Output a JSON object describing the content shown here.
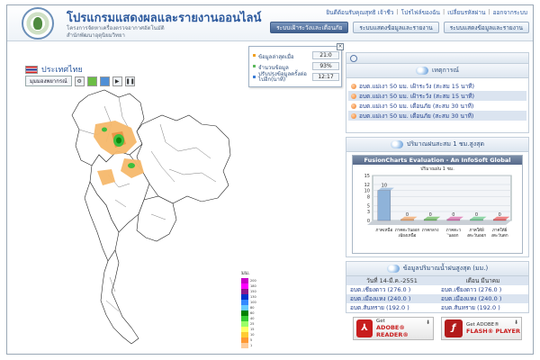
{
  "header": {
    "title": "โปรแกรมแสดงผลและรายงานออนไลน์",
    "subtitle_1": "โครงการจัดหาเครื่องตรวจอากาศอัตโนมัติ",
    "subtitle_2": "สำนักพัฒนาอุตุนิยมวิทยา",
    "top_links": [
      "ยินดีต้อนรับคุณสุทธิ เจ้าชีว",
      "โปรไฟล์ของฉัน",
      "เปลี่ยนรหัสผ่าน",
      "ออกจากระบบ"
    ],
    "nav": [
      "ระบบเฝ้าระวังและเตือนภัย",
      "ระบบแสดงข้อมูลและรายงาน",
      "ระบบแสดงข้อมูลและรายงาน"
    ]
  },
  "map": {
    "country_label": "ประเทศไทย",
    "select_value": "มุมมองพยากรณ์",
    "info_box": {
      "rows": [
        {
          "label": "ข้อมูลล่าสุดเมื่อ",
          "value": "21:0",
          "color": "#f0a020"
        },
        {
          "label": "จำนวนข้อมูล",
          "value": "93%",
          "color": "#5cb85c"
        },
        {
          "label": "ปรับปรุงข้อมูลครั้งต่อไปอีก(นาที)",
          "value": "12:17",
          "color": "#3a7bd5"
        }
      ]
    },
    "legend": {
      "title": "มม.",
      "levels": [
        {
          "label": "200",
          "color": "#c800c8"
        },
        {
          "label": "180",
          "color": "#ff00ff"
        },
        {
          "label": "150",
          "color": "#8c1a8c"
        },
        {
          "label": "130",
          "color": "#0033cc"
        },
        {
          "label": "100",
          "color": "#3388ff"
        },
        {
          "label": "80",
          "color": "#66ccff"
        },
        {
          "label": "60",
          "color": "#008000"
        },
        {
          "label": "40",
          "color": "#33cc33"
        },
        {
          "label": "25",
          "color": "#99ff66"
        },
        {
          "label": "15",
          "color": "#ffff66"
        },
        {
          "label": "10",
          "color": "#ffcc33"
        },
        {
          "label": "5",
          "color": "#ff9933"
        },
        {
          "label": "1",
          "color": "#ffcc99"
        }
      ]
    }
  },
  "events": {
    "title": "เหตุการณ์",
    "items": [
      "อบต.แม่เงา 50 มม. เฝ้าระวัง (สะสม 15 นาที)",
      "อบต.แม่เงา 50 มม. เฝ้าระวัง (สะสม 15 นาที)",
      "อบต.แม่เงา 50 มม. เตือนภัย (สะสม 30 นาที)",
      "อบต.แม่เงา 50 มม. เตือนภัย (สะสม 30 นาที)"
    ]
  },
  "rain_panel": {
    "title": "ปริมาณฝนสะสม 1 ชม.สูงสุด",
    "chart_title": "FusionCharts Evaluation - An InfoSoft Global",
    "chart_subtitle": "ปริมาณฝน 1 ชม."
  },
  "chart_data": {
    "type": "bar",
    "title": "ปริมาณฝน 1 ชม.",
    "categories": [
      "ภาคเหนือ",
      "ภาคตะวันออกเฉียงเหนือ",
      "ภาคกลาง",
      "ภาคตะวันออก",
      "ภาคใต้ฝั่งตะวันออก",
      "ภาคใต้ฝั่งตะวันตก"
    ],
    "values": [
      10,
      0,
      0,
      0,
      0,
      0
    ],
    "ylim": [
      0,
      15
    ],
    "yticks": [
      0,
      3,
      5,
      8,
      10,
      12,
      15
    ],
    "grid": true,
    "colors": [
      "#8fb3d9",
      "#f4a460",
      "#66bb55",
      "#dd66aa",
      "#66cc88",
      "#ee5555"
    ]
  },
  "max_rain": {
    "title": "ข้อมูลปริมาณน้ำฝนสูงสุด (มม.)",
    "col_left": "วันที่ 14-มี.ค.-2551",
    "col_right": "เดือน มีนาคม",
    "rows": [
      [
        "อบต.เชียงดาว (276.0 )",
        "อบต.เชียงดาว (276.0 )"
      ],
      [
        "อบต.เมืองแหง (240.0 )",
        "อบต.เมืองแหง (240.0 )"
      ],
      [
        "อบต.สันทราย (192.0 )",
        "อบต.สันทราย (192.0 )"
      ]
    ]
  },
  "downloads": {
    "reader": {
      "get": "Get",
      "name": "ADOBE® READER®"
    },
    "flash": {
      "get": "Get ADOBE®",
      "name": "FLASH® PLAYER"
    }
  }
}
